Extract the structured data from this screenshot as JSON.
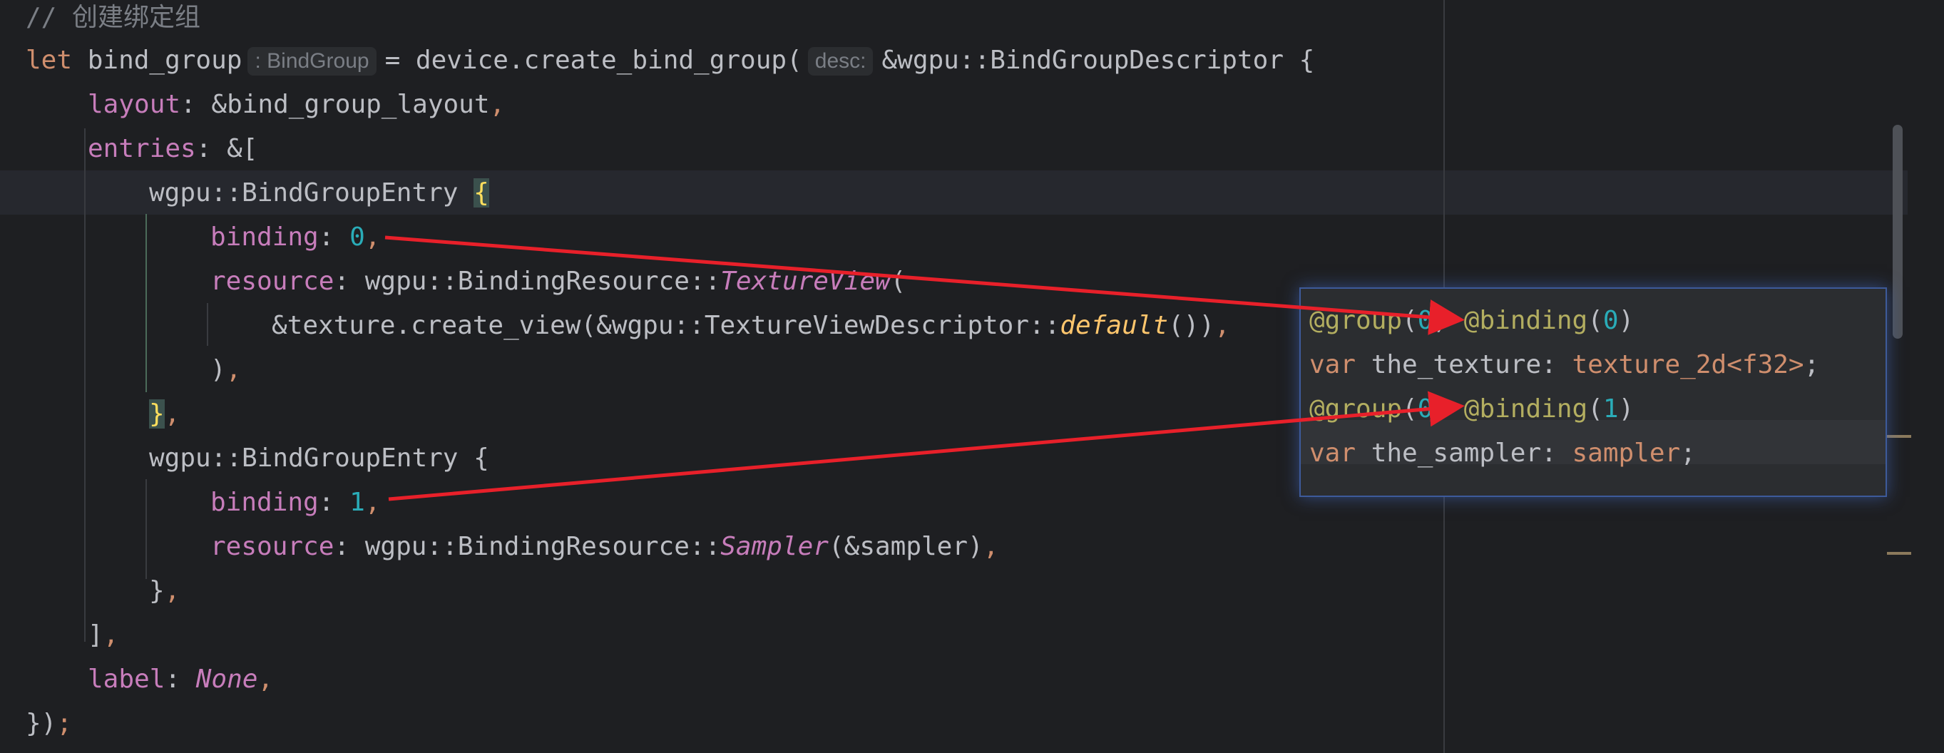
{
  "code": {
    "comment": "// 创建绑定组",
    "let_kw": "let",
    "var_name": "bind_group",
    "type_hint": ": BindGroup",
    "call": "= device.create_bind_group(",
    "param_hint": "desc:",
    "descriptor": "&wgpu::BindGroupDescriptor {",
    "layout_key": "layout",
    "layout_val": ": &bind_group_layout",
    "entries_key": "entries",
    "entries_val": ": &[",
    "entry_type": "wgpu::BindGroupEntry ",
    "open_brace": "{",
    "binding_key": "binding",
    "binding0": "0",
    "resource_key": "resource",
    "resource_path": ": wgpu::BindingResource::",
    "texture_view": "TextureView",
    "open_paren": "(",
    "create_view": "&texture.create_view(&wgpu::TextureViewDescriptor::",
    "default_fn": "default",
    "default_tail": "())",
    "close_paren": ")",
    "close_brace": "}",
    "entry2": "wgpu::BindGroupEntry {",
    "binding1": "1",
    "sampler": "Sampler",
    "sampler_arg": "(&sampler)",
    "close_entry": "}",
    "close_bracket": "]",
    "label_key": "label",
    "label_val": "None",
    "end": "})",
    "semicolon": ";",
    "comma": ",",
    "colon": ": "
  },
  "wgsl": {
    "group_attr": "@group",
    "group_open": "(",
    "group_num": "0",
    "group_close": ")",
    "binding_attr": "@binding",
    "binding_open": "(",
    "binding_num0": "0",
    "binding_num1": "1",
    "binding_close": ")",
    "var_kw": "var",
    "texture_name": " the_texture: ",
    "texture_type": "texture_2d",
    "texture_generic": "<f32>",
    "sampler_name": " the_sampler: ",
    "sampler_type": "sampler",
    "semicolon": ";"
  },
  "colors": {
    "background": "#1e1f22",
    "arrow": "#e8202a",
    "popup_border": "#3d5a9a"
  }
}
